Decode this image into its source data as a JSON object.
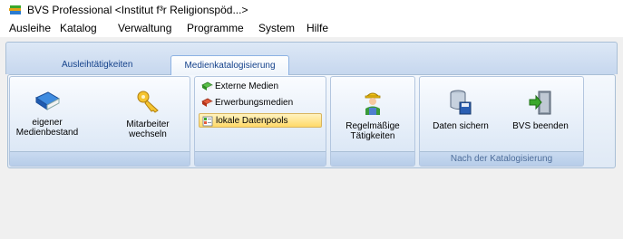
{
  "window": {
    "title": "BVS Professional <Institut f³r Religionspöd...>"
  },
  "menu": [
    "Ausleihe",
    "Katalog",
    "Verwaltung",
    "Programme",
    "System",
    "Hilfe"
  ],
  "tabs": {
    "inactive": "Ausleihtätigkeiten",
    "active": "Medienkatalogisierung"
  },
  "ribbon": {
    "eigener": [
      "eigener",
      "Medienbestand"
    ],
    "mitarbeiter": [
      "Mitarbeiter",
      "wechseln"
    ],
    "small_buttons": [
      "Externe Medien",
      "Erwerbungsmedien",
      "lokale Datenpools"
    ],
    "regel": [
      "Regelmäßige",
      "Tätigkeiten"
    ],
    "daten": "Daten sichern",
    "beenden": "BVS beenden",
    "group_caption": "Nach der Katalogisierung"
  },
  "colors": {
    "ribbon_text": "#15428b",
    "selected": "#ffd968",
    "accent_green": "#3aa82a"
  },
  "icons": {
    "app": "book-stack-icon",
    "eigener": "blue-book-icon",
    "mitarbeiter": "keys-icon",
    "externe": "green-book-icon",
    "erwerbung": "red-book-icon",
    "lokale": "database-list-icon",
    "regel": "worker-icon",
    "daten": "database-save-icon",
    "beenden": "exit-door-icon"
  }
}
